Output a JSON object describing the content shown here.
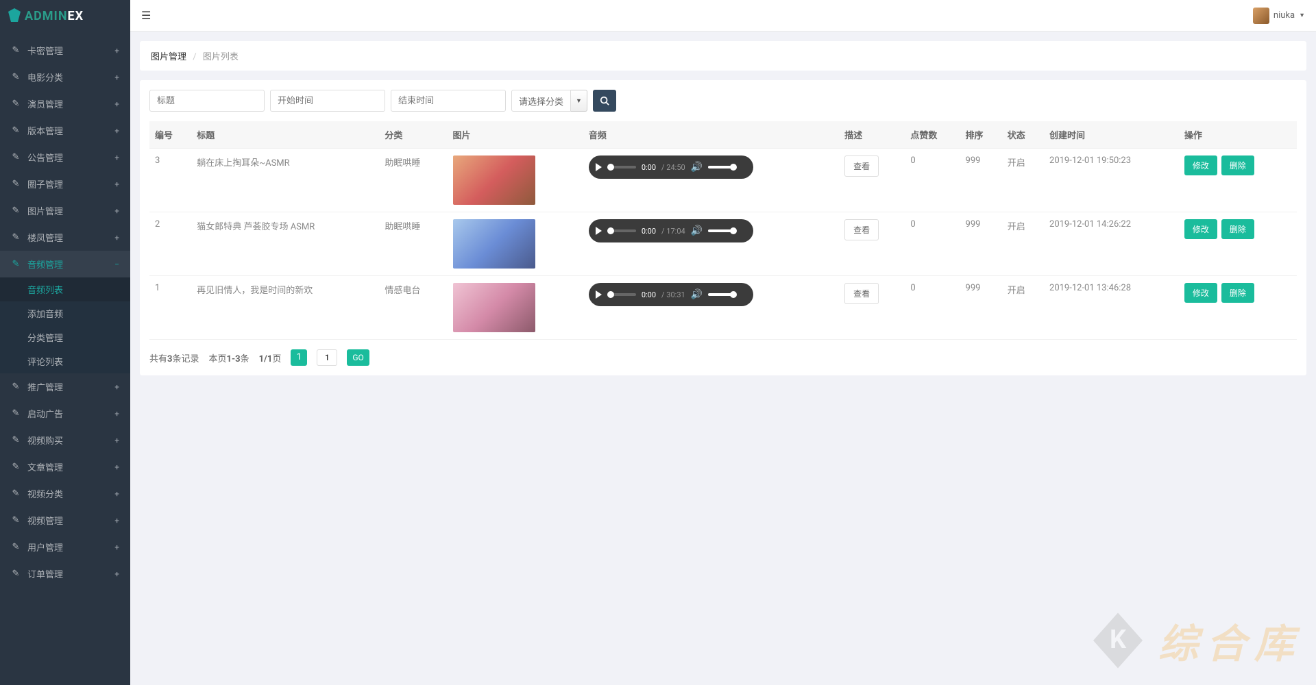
{
  "brand": {
    "prefix": "ADMIN",
    "suffix": "EX"
  },
  "user": {
    "name": "niuka"
  },
  "sidebar": {
    "items": [
      {
        "label": "卡密管理",
        "expand": "+"
      },
      {
        "label": "电影分类",
        "expand": "+"
      },
      {
        "label": "演员管理",
        "expand": "+"
      },
      {
        "label": "版本管理",
        "expand": "+"
      },
      {
        "label": "公告管理",
        "expand": "+"
      },
      {
        "label": "圈子管理",
        "expand": "+"
      },
      {
        "label": "图片管理",
        "expand": "+"
      },
      {
        "label": "楼凤管理",
        "expand": "+"
      },
      {
        "label": "音频管理",
        "expand": "−",
        "active": true,
        "children": [
          {
            "label": "音频列表",
            "selected": true
          },
          {
            "label": "添加音频"
          },
          {
            "label": "分类管理"
          },
          {
            "label": "评论列表"
          }
        ]
      },
      {
        "label": "推广管理",
        "expand": "+"
      },
      {
        "label": "启动广告",
        "expand": "+"
      },
      {
        "label": "视频购买",
        "expand": "+"
      },
      {
        "label": "文章管理",
        "expand": "+"
      },
      {
        "label": "视频分类",
        "expand": "+"
      },
      {
        "label": "视频管理",
        "expand": "+"
      },
      {
        "label": "用户管理",
        "expand": "+"
      },
      {
        "label": "订单管理",
        "expand": "+"
      }
    ]
  },
  "breadcrumb": {
    "current": "图片管理",
    "sub": "图片列表"
  },
  "filters": {
    "title_placeholder": "标题",
    "start_placeholder": "开始时间",
    "end_placeholder": "结束时间",
    "category_label": "请选择分类"
  },
  "table": {
    "headers": [
      "编号",
      "标题",
      "分类",
      "图片",
      "音频",
      "描述",
      "点赞数",
      "排序",
      "状态",
      "创建时间",
      "操作"
    ],
    "view_label": "查看",
    "edit_label": "修改",
    "delete_label": "删除",
    "rows": [
      {
        "id": "3",
        "title": "躺在床上掏耳朵~ASMR",
        "category": "助眠哄睡",
        "cur": "0:00",
        "dur": "24:50",
        "likes": "0",
        "sort": "999",
        "status": "开启",
        "created": "2019-12-01 19:50:23",
        "img": "linear-gradient(135deg,#e8a87c,#d45d5d,#8e5a3c)"
      },
      {
        "id": "2",
        "title": "猫女郎特典 芦荟胶专场 ASMR",
        "category": "助眠哄睡",
        "cur": "0:00",
        "dur": "17:04",
        "likes": "0",
        "sort": "999",
        "status": "开启",
        "created": "2019-12-01 14:26:22",
        "img": "linear-gradient(135deg,#a8c8ec,#6b8dd6,#4a5a8c)"
      },
      {
        "id": "1",
        "title": "再见旧情人，我是时间的新欢",
        "category": "情感电台",
        "cur": "0:00",
        "dur": "30:31",
        "likes": "0",
        "sort": "999",
        "status": "开启",
        "created": "2019-12-01 13:46:28",
        "img": "linear-gradient(135deg,#f0c4d4,#d48aa8,#8c5a6b)"
      }
    ]
  },
  "pagination": {
    "total_prefix": "共有",
    "total_count": "3",
    "total_suffix": "条记录",
    "range_prefix": "本页",
    "range": "1-3",
    "range_suffix": "条",
    "pages_prefix": "",
    "pages": "1/1",
    "pages_suffix": "页",
    "current_page": "1",
    "input_value": "1",
    "go_label": "GO"
  },
  "watermark": {
    "text": "综合库"
  }
}
